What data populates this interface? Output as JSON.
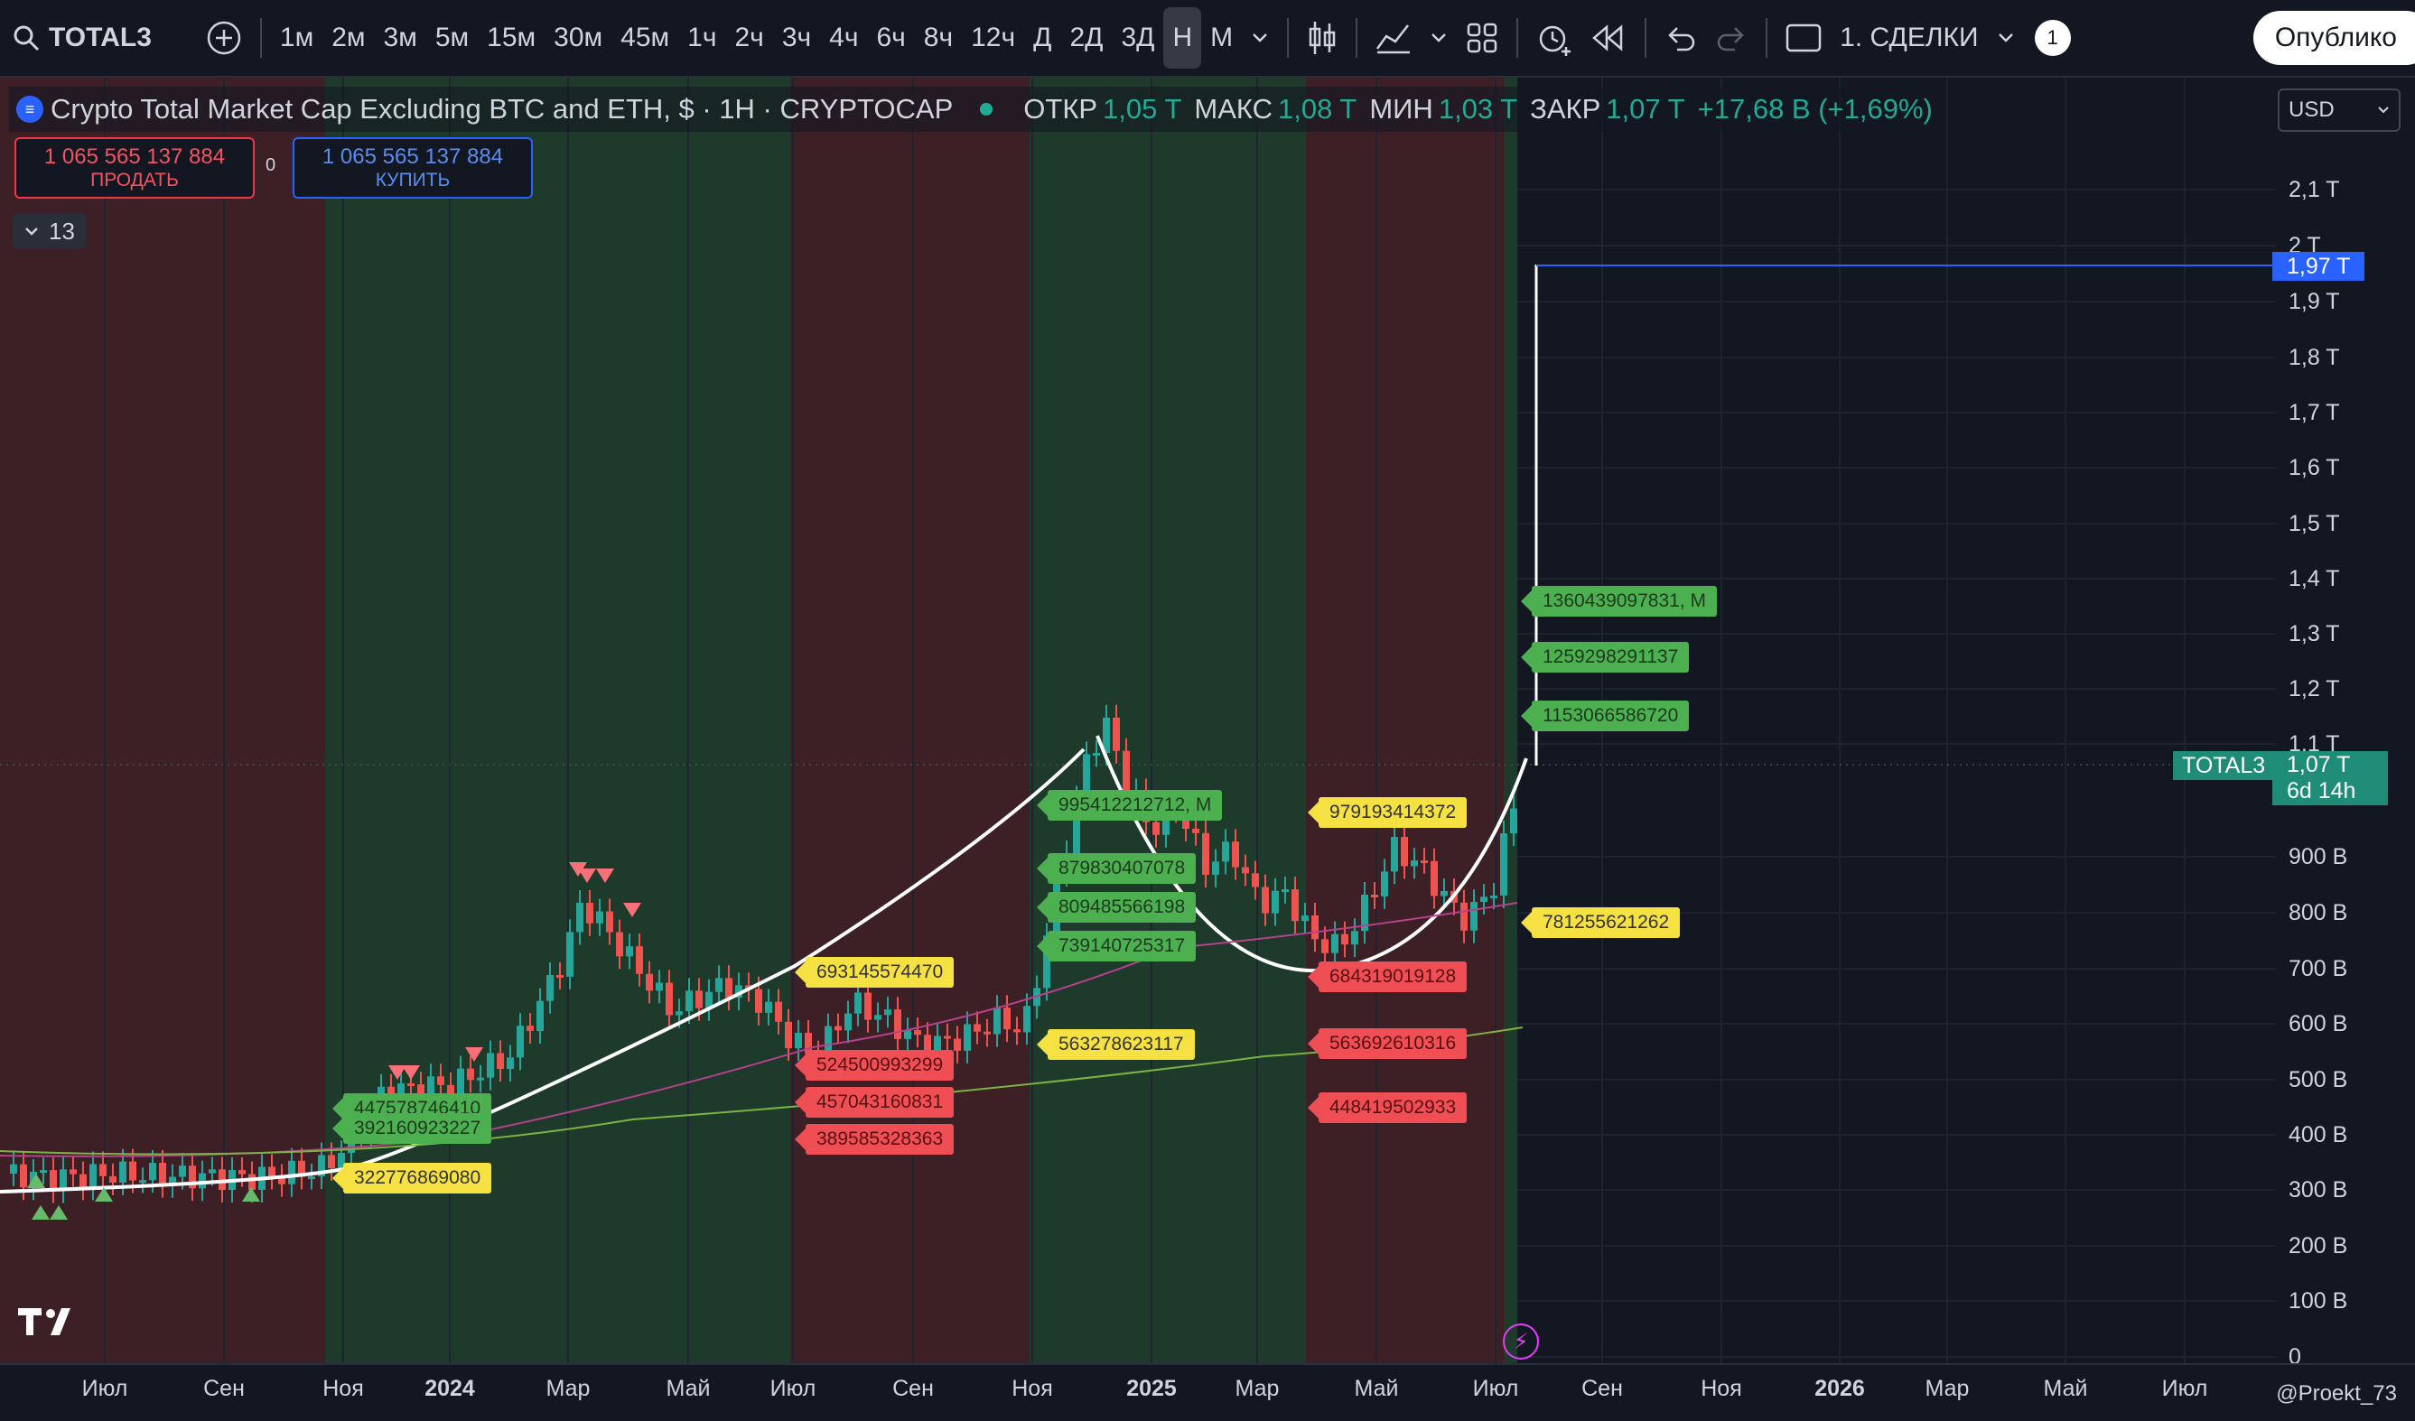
{
  "toolbar": {
    "symbol": "TOTAL3",
    "intervals": [
      "1м",
      "2м",
      "3м",
      "5м",
      "15м",
      "30м",
      "45м",
      "1ч",
      "2ч",
      "3ч",
      "4ч",
      "6ч",
      "8ч",
      "12ч",
      "Д",
      "2Д",
      "3Д",
      "Н",
      "М"
    ],
    "active_interval": "Н",
    "trades_label": "1. СДЕЛКИ",
    "alerts_count": "1",
    "publish_label": "Опублико"
  },
  "legend": {
    "title": "Crypto Total Market Cap Excluding BTC and ETH, $ · 1Н · CRYPTOCAP",
    "open_label": "ОТКР",
    "open": "1,05 T",
    "high_label": "МАКС",
    "high": "1,08 T",
    "low_label": "МИН",
    "low": "1,03 T",
    "close_label": "ЗАКР",
    "close": "1,07 T",
    "change": "+17,68 B (+1,69%)"
  },
  "trade": {
    "sell_price": "1 065 565 137 884",
    "sell_label": "ПРОДАТЬ",
    "spread": "0",
    "buy_price": "1 065 565 137 884",
    "buy_label": "КУПИТЬ"
  },
  "indicators_collapsed": "13",
  "currency": "USD",
  "y_axis": [
    "2,1 T",
    "2 T",
    "1,9 T",
    "1,8 T",
    "1,7 T",
    "1,6 T",
    "1,5 T",
    "1,4 T",
    "1,3 T",
    "1,2 T",
    "1,1 T",
    "900 B",
    "800 B",
    "700 B",
    "600 B",
    "500 B",
    "400 B",
    "300 B",
    "200 B",
    "100 B",
    "0"
  ],
  "x_axis": [
    {
      "label": "Июл",
      "bold": false
    },
    {
      "label": "Сен",
      "bold": false
    },
    {
      "label": "Ноя",
      "bold": false
    },
    {
      "label": "2024",
      "bold": true
    },
    {
      "label": "Мар",
      "bold": false
    },
    {
      "label": "Май",
      "bold": false
    },
    {
      "label": "Июл",
      "bold": false
    },
    {
      "label": "Сен",
      "bold": false
    },
    {
      "label": "Ноя",
      "bold": false
    },
    {
      "label": "2025",
      "bold": true
    },
    {
      "label": "Мар",
      "bold": false
    },
    {
      "label": "Май",
      "bold": false
    },
    {
      "label": "Июл",
      "bold": false
    },
    {
      "label": "Сен",
      "bold": false
    },
    {
      "label": "Ноя",
      "bold": false
    },
    {
      "label": "2026",
      "bold": true
    },
    {
      "label": "Мар",
      "bold": false
    },
    {
      "label": "Май",
      "bold": false
    },
    {
      "label": "Июл",
      "bold": false
    }
  ],
  "price_labels": {
    "target": "1,97 T",
    "symbol_tag": "TOTAL3",
    "current": "1,07 T",
    "countdown": "6d 14h"
  },
  "level_tags": [
    {
      "text": "1360439097831, M",
      "color": "g"
    },
    {
      "text": "1259298291137",
      "color": "g"
    },
    {
      "text": "1153066586720",
      "color": "g"
    },
    {
      "text": "781255621262",
      "color": "y"
    },
    {
      "text": "979193414372",
      "color": "y"
    },
    {
      "text": "684319019128",
      "color": "r"
    },
    {
      "text": "563692610316",
      "color": "r"
    },
    {
      "text": "448419502933",
      "color": "r"
    },
    {
      "text": "995412212712, M",
      "color": "g"
    },
    {
      "text": "879830407078",
      "color": "g"
    },
    {
      "text": "809485566198",
      "color": "g"
    },
    {
      "text": "739140725317",
      "color": "g"
    },
    {
      "text": "563278623117",
      "color": "y"
    },
    {
      "text": "693145574470",
      "color": "y"
    },
    {
      "text": "524500993299",
      "color": "r"
    },
    {
      "text": "457043160831",
      "color": "r"
    },
    {
      "text": "389585328363",
      "color": "r"
    },
    {
      "text": "447578746410",
      "color": "g"
    },
    {
      "text": "392160923227",
      "color": "g"
    },
    {
      "text": "322776869080",
      "color": "y"
    }
  ],
  "author": "@Proekt_73",
  "colors": {
    "bg": "#131722",
    "green_zone": "#1e3a2a",
    "red_zone": "#3d1f26",
    "up": "#26a69a",
    "down": "#ef5350"
  }
}
